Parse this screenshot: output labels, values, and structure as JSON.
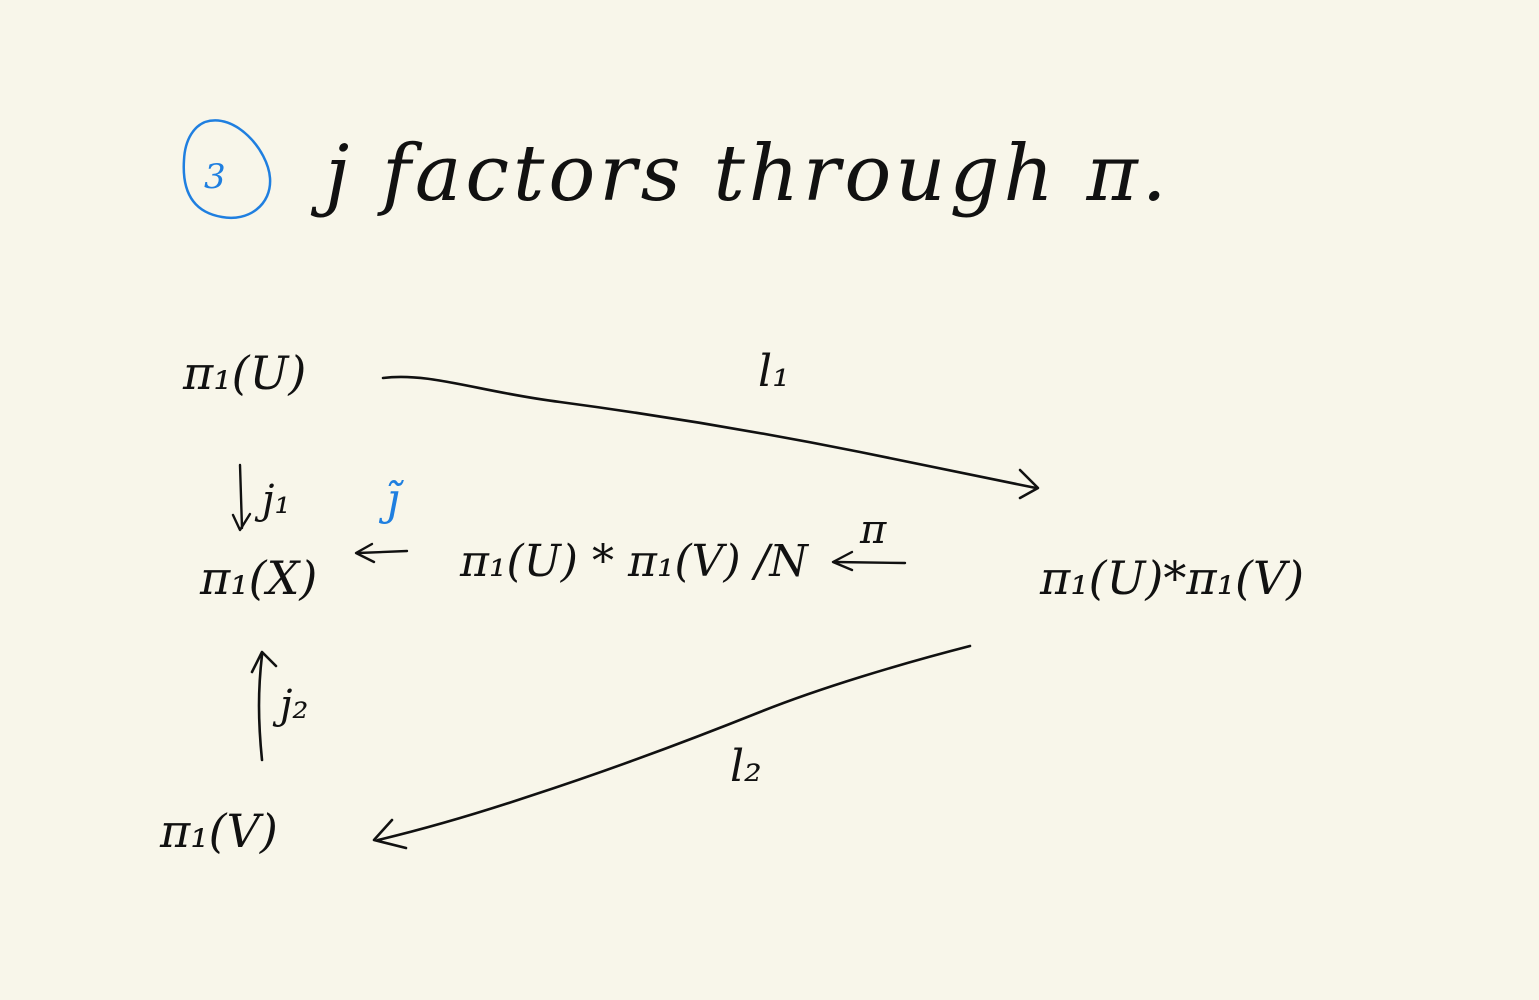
{
  "colors": {
    "ink": "#111111",
    "accent": "#1f7fe0",
    "paper": "#f8f6ea"
  },
  "heading": {
    "number": "3",
    "text": "j  factors through π."
  },
  "nodes": {
    "top_left": "π₁(U)",
    "mid_left": "π₁(X)",
    "bottom_left": "π₁(V)",
    "quotient": "π₁(U) * π₁(V) /N",
    "free_product": "π₁(U)*π₁(V)"
  },
  "labels": {
    "l1": "l₁",
    "l2": "l₂",
    "j1": "j₁",
    "j2": "j₂",
    "j_tilde": "j̃",
    "pi": "π"
  }
}
